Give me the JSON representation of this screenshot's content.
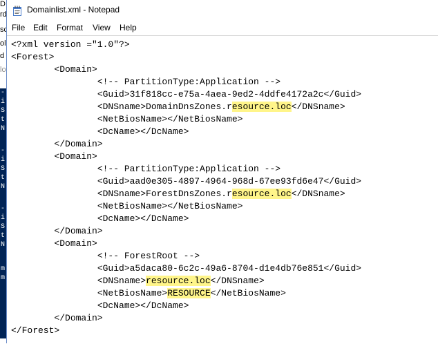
{
  "window": {
    "title": "Domainlist.xml - Notepad",
    "menu": [
      "File",
      "Edit",
      "Format",
      "View",
      "Help"
    ]
  },
  "background_window": {
    "fragments": [
      "D",
      "rd",
      "sc",
      "ol",
      "d",
      "lo"
    ],
    "console_text": [
      "-",
      "i",
      "S",
      "t",
      "N",
      "-",
      "i",
      "S",
      "t",
      "N",
      "-",
      "i",
      "S",
      "t",
      "N",
      "m",
      "m"
    ]
  },
  "highlight_color": "#fff58a",
  "document": {
    "lines": [
      {
        "pre": "<?xml version =\"1.0\"?>"
      },
      {
        "pre": "<Forest>"
      },
      {
        "pre": "        <Domain>"
      },
      {
        "pre": "                <!-- PartitionType:Application -->"
      },
      {
        "pre": "                <Guid>31f818cc-e75a-4aea-9ed2-4ddfe4172a2c</Guid>"
      },
      {
        "pre": "                <DNSname>DomainDnsZones.r",
        "hl": "esource.loc",
        "post": "</DNSname>"
      },
      {
        "pre": "                <NetBiosName></NetBiosName>"
      },
      {
        "pre": "                <DcName></DcName>"
      },
      {
        "pre": "        </Domain>"
      },
      {
        "pre": "        <Domain>"
      },
      {
        "pre": "                <!-- PartitionType:Application -->"
      },
      {
        "pre": "                <Guid>aad0e305-4897-4964-968d-67ee93fd6e47</Guid>"
      },
      {
        "pre": "                <DNSname>ForestDnsZones.r",
        "hl": "esource.loc",
        "post": "</DNSname>"
      },
      {
        "pre": "                <NetBiosName></NetBiosName>"
      },
      {
        "pre": "                <DcName></DcName>"
      },
      {
        "pre": "        </Domain>"
      },
      {
        "pre": "        <Domain>"
      },
      {
        "pre": "                <!-- ForestRoot -->"
      },
      {
        "pre": "                <Guid>a5daca80-6c2c-49a6-8704-d1e4db76e851</Guid>"
      },
      {
        "pre": "                <DNSname>",
        "hl": "resource.loc",
        "post": "</DNSname>"
      },
      {
        "pre": "                <NetBiosName>",
        "hl": "RESOURCE",
        "post": "</NetBiosName>"
      },
      {
        "pre": "                <DcName></DcName>"
      },
      {
        "pre": "        </Domain>"
      },
      {
        "pre": "</Forest>"
      }
    ]
  }
}
